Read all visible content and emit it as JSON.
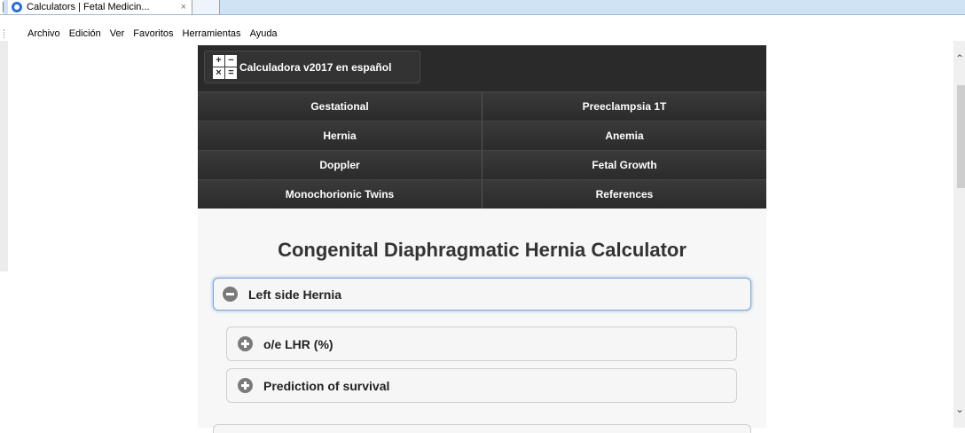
{
  "browser": {
    "tab_title": "Calculators | Fetal Medicin...",
    "tab_close": "×",
    "menu": [
      "Archivo",
      "Edición",
      "Ver",
      "Favoritos",
      "Herramientas",
      "Ayuda"
    ]
  },
  "site": {
    "calc_button": {
      "icon_glyphs": [
        "+",
        "−",
        "×",
        "="
      ],
      "label": "Calculadora v2017 en español"
    },
    "nav": [
      [
        "Gestational",
        "Preeclampsia 1T"
      ],
      [
        "Hernia",
        "Anemia"
      ],
      [
        "Doppler",
        "Fetal Growth"
      ],
      [
        "Monochorionic Twins",
        "References"
      ]
    ],
    "page_title": "Congenital Diaphragmatic Hernia Calculator",
    "sections": {
      "main": "Left side Hernia",
      "sub1": "o/e LHR (%)",
      "sub2": "Prediction of survival"
    }
  },
  "colors": {
    "accent": "#2a6fd6",
    "nav_bg": "#2a2a2a"
  },
  "icons": {
    "scroll_up": "⌃",
    "scroll_down": "⌄"
  }
}
